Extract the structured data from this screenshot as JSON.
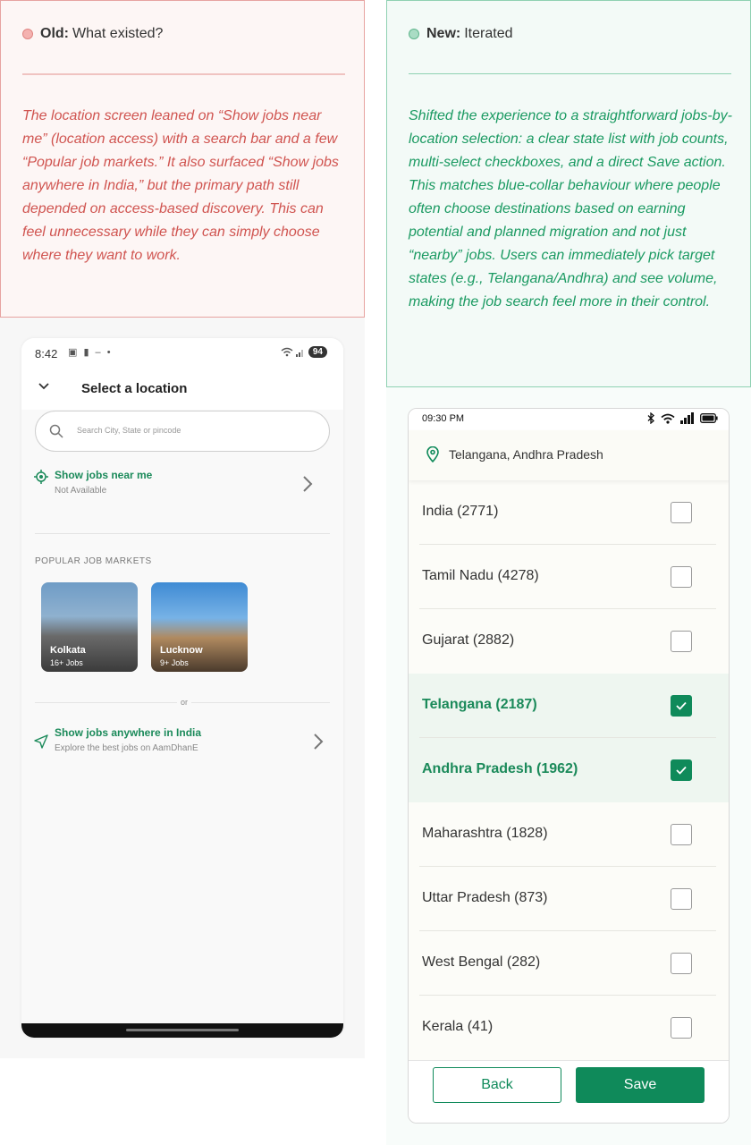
{
  "old": {
    "tag_strong": "Old:",
    "tag_text": "What existed?",
    "description": "The location screen leaned on “Show jobs near me” (location access) with a search bar and a few “Popular job markets.” It also surfaced “Show jobs anywhere in India,” but the primary path still depended on access-based discovery. This can feel unnecessary while they can simply choose where they want to work.",
    "phone": {
      "time": "8:42",
      "battery": "94",
      "title": "Select a location",
      "search_placeholder": "Search City, State or pincode",
      "near_title": "Show jobs near me",
      "near_sub": "Not Available",
      "popular_heading": "POPULAR JOB MARKETS",
      "cities": [
        {
          "name": "Kolkata",
          "jobs": "16+ Jobs"
        },
        {
          "name": "Lucknow",
          "jobs": "9+ Jobs"
        }
      ],
      "or_text": "or",
      "anywhere_title": "Show jobs anywhere in India",
      "anywhere_sub": "Explore the best jobs on AamDhanE"
    }
  },
  "new": {
    "tag_strong": "New:",
    "tag_text": "Iterated",
    "description": "Shifted the experience to a straightforward jobs-by-location selection: a clear state list with job counts, multi-select checkboxes, and a direct Save action. This matches blue-collar behaviour where people often choose destinations based on earning potential and planned migration and not just “nearby” jobs. Users can immediately pick target states (e.g., Telangana/Andhra) and see volume, making the job search feel more in their control.",
    "phone": {
      "time": "09:30 PM",
      "selected_locations": "Telangana, Andhra Pradesh",
      "states": [
        {
          "label": "India (2771)",
          "checked": false
        },
        {
          "label": "Tamil Nadu (4278)",
          "checked": false
        },
        {
          "label": "Gujarat (2882)",
          "checked": false
        },
        {
          "label": "Telangana (2187)",
          "checked": true
        },
        {
          "label": "Andhra Pradesh (1962)",
          "checked": true
        },
        {
          "label": "Maharashtra (1828)",
          "checked": false
        },
        {
          "label": "Uttar Pradesh (873)",
          "checked": false
        },
        {
          "label": "West Bengal (282)",
          "checked": false
        },
        {
          "label": "Kerala (41)",
          "checked": false
        }
      ],
      "back_label": "Back",
      "save_label": "Save"
    }
  },
  "colors": {
    "old_accent": "#d05450",
    "new_accent": "#1b9a62",
    "primary_green": "#0f8a5a"
  }
}
